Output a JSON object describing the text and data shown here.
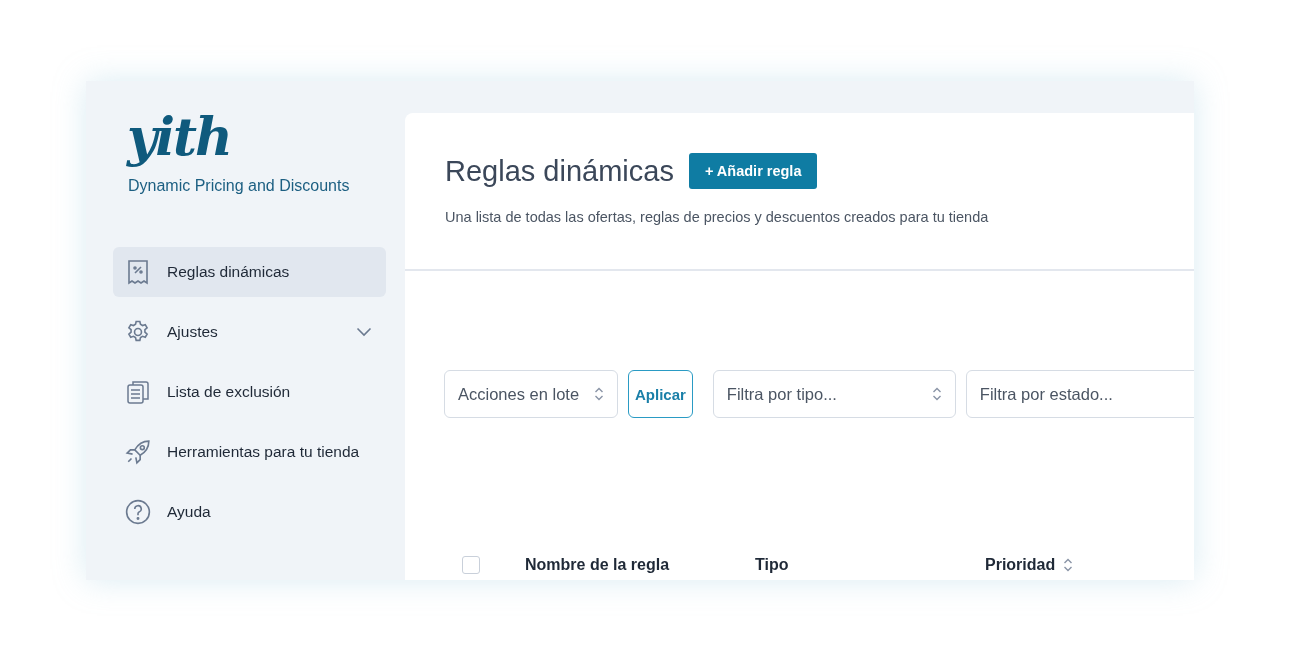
{
  "sidebar": {
    "logo": "yith",
    "product": "Dynamic Pricing and Discounts",
    "items": [
      {
        "label": "Reglas dinámicas",
        "kind": "link",
        "selected": true
      },
      {
        "label": "Ajustes",
        "kind": "submenu",
        "selected": false
      },
      {
        "label": "Lista de exclusión",
        "kind": "link",
        "selected": false
      },
      {
        "label": "Herramientas para tu tienda",
        "kind": "link",
        "selected": false
      },
      {
        "label": "Ayuda",
        "kind": "link",
        "selected": false
      }
    ]
  },
  "header": {
    "title": "Reglas dinámicas",
    "add_button": "+ Añadir regla",
    "description": "Una lista de todas las ofertas, reglas de precios y descuentos creados para tu tienda"
  },
  "toolbar": [
    {
      "kind": "select",
      "value": "Acciones en lote",
      "arrows": true
    },
    {
      "kind": "button",
      "label": "Aplicar"
    },
    {
      "kind": "select",
      "placeholder": "Filtra por tipo...",
      "arrows": true
    },
    {
      "kind": "select",
      "placeholder": "Filtra por estado..."
    }
  ],
  "table": {
    "select_all": {
      "checked": false
    },
    "columns": [
      {
        "label": "Nombre de la regla",
        "sortable": false
      },
      {
        "label": "Tipo",
        "sortable": false
      },
      {
        "label": "Prioridad",
        "sortable": true
      }
    ]
  }
}
